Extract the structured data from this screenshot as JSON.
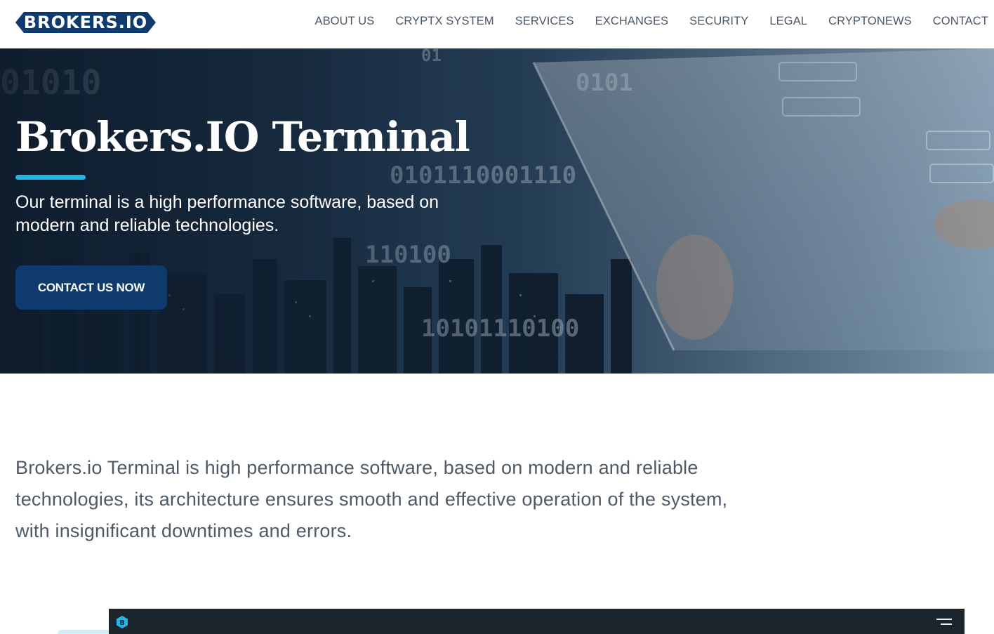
{
  "header": {
    "logo_text": "BROKERS.IO",
    "nav": [
      "ABOUT US",
      "CRYPTX SYSTEM",
      "SERVICES",
      "EXCHANGES",
      "SECURITY",
      "LEGAL",
      "CRYPTONEWS",
      "CONTACT"
    ]
  },
  "hero": {
    "title": "Brokers.IO Terminal",
    "subtitle": "Our terminal is a high performance software, based on modern and reliable technologies.",
    "cta_label": "CONTACT US NOW",
    "binary_strings": [
      "01010",
      "0101",
      "0101110001110",
      "110100",
      "10101110100",
      "01"
    ]
  },
  "intro": {
    "text": "Brokers.io Terminal is high performance software, based on modern and reliable technologies, its architecture ensures smooth and effective operation of the system, with insignificant downtimes and errors."
  },
  "terminal": {
    "logo_icon": "b-logo-icon",
    "menu_icon": "menu-icon"
  },
  "colors": {
    "brand": "#0f3a6e",
    "accent": "#22b6e6",
    "terminal_bar": "#1d252c"
  }
}
